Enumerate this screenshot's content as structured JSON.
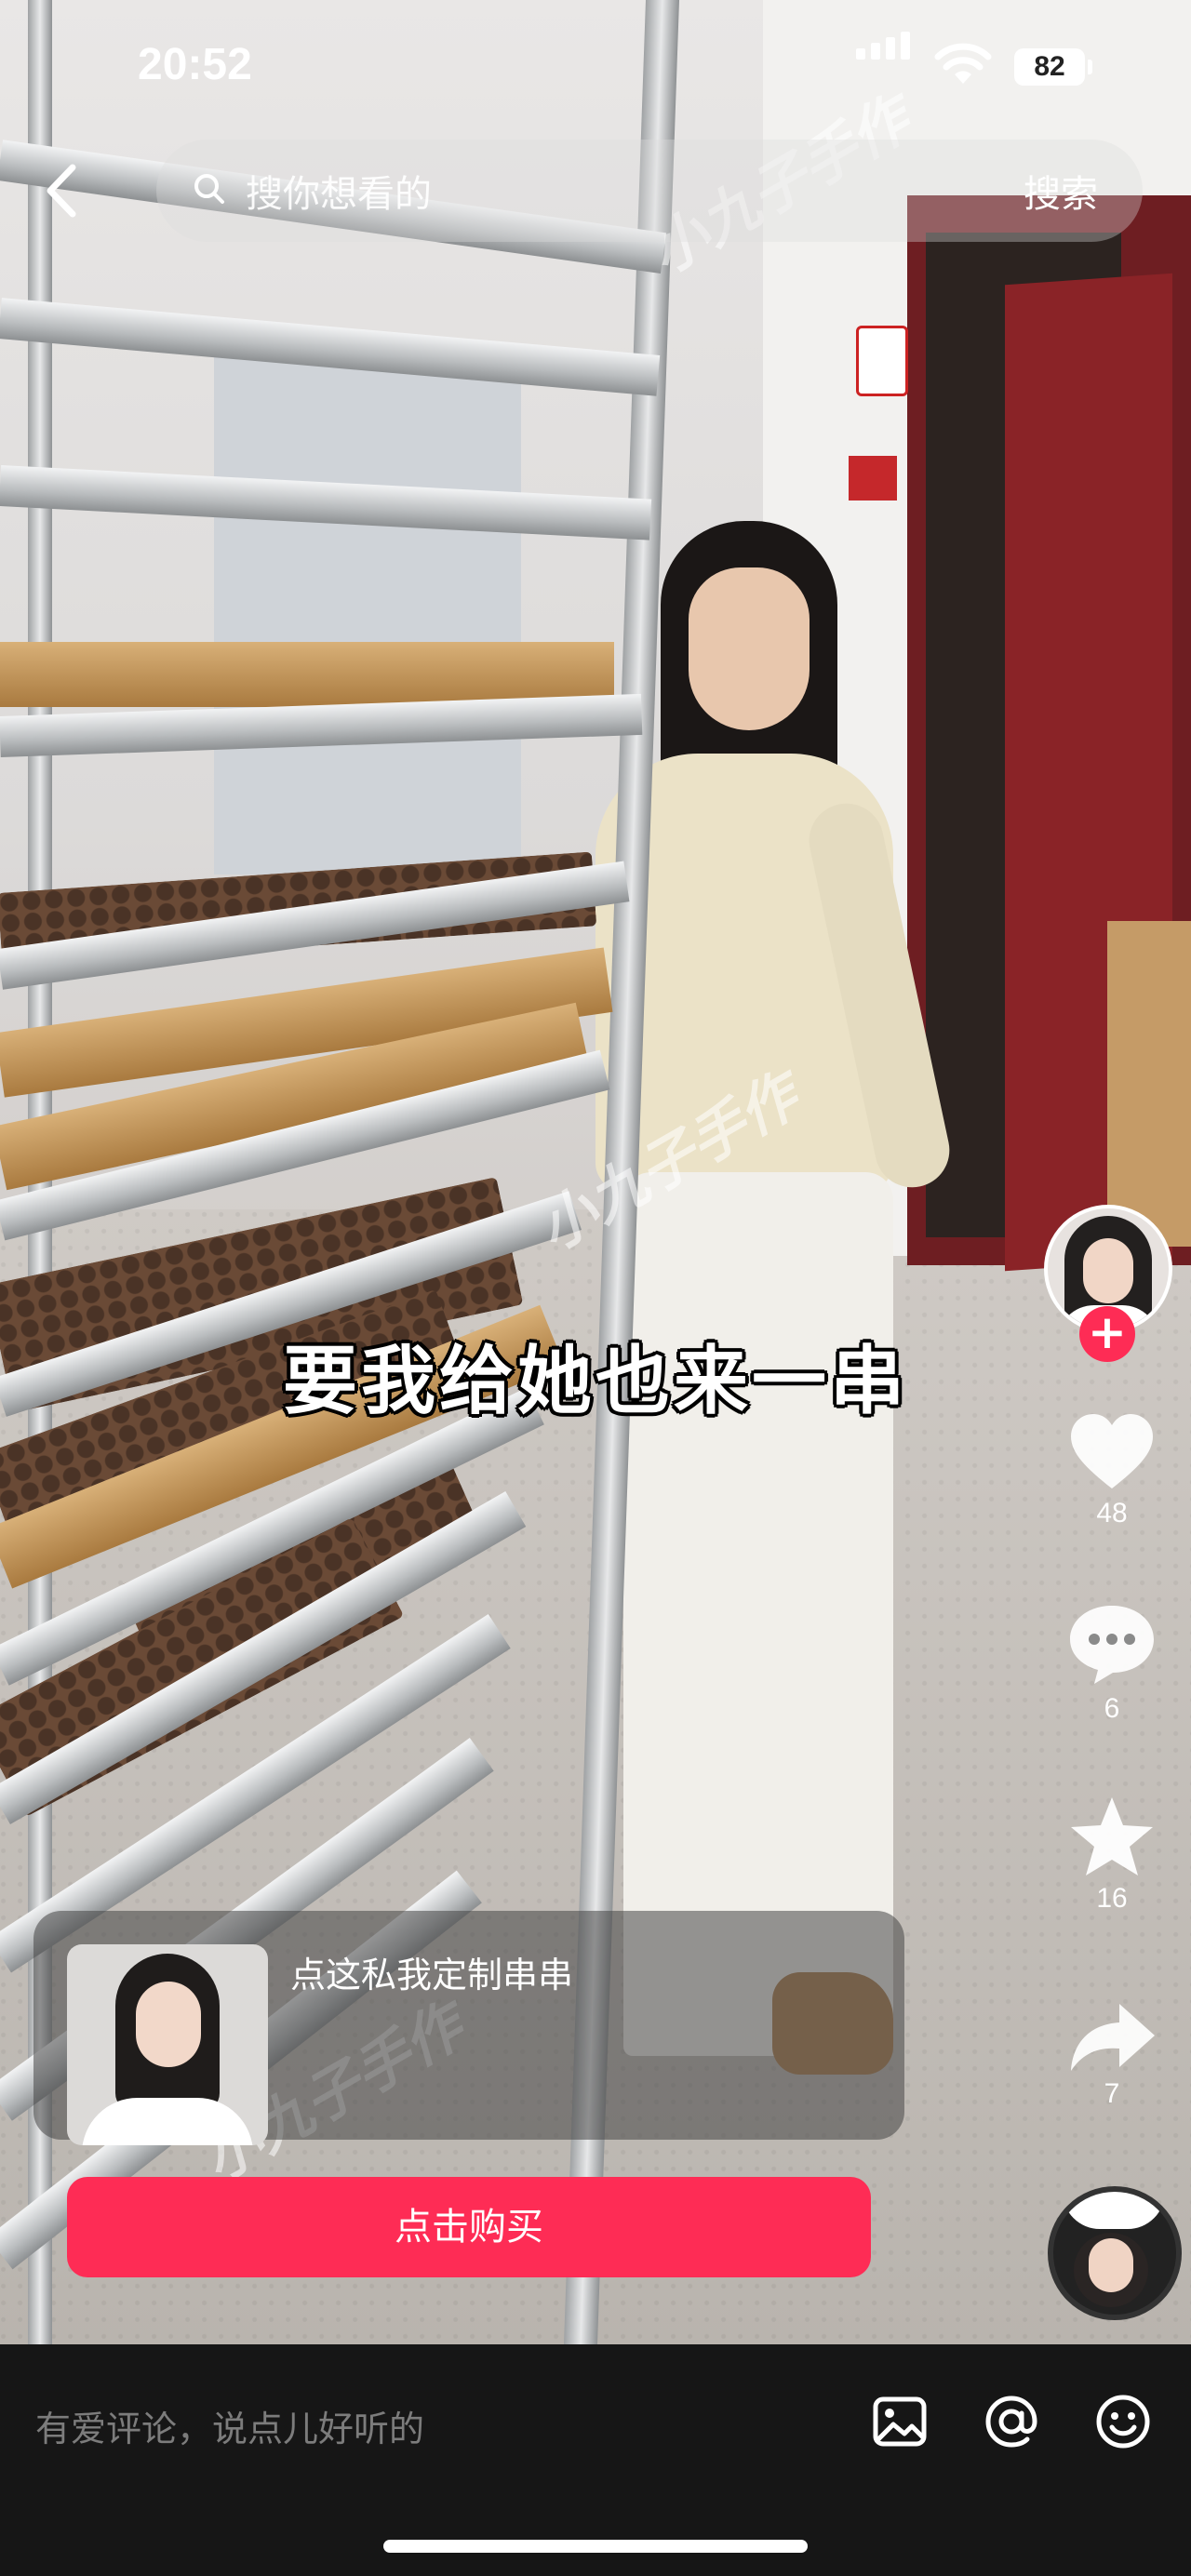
{
  "status_bar": {
    "time": "20:52",
    "battery": "82"
  },
  "top_bar": {
    "search_placeholder": "搜你想看的",
    "search_button": "搜索"
  },
  "video": {
    "caption": "要我给她也来一串",
    "watermark": "小九子手作"
  },
  "side_actions": {
    "likes": "48",
    "comments": "6",
    "favorites": "16",
    "shares": "7",
    "icons": [
      "plus-icon",
      "heart-icon",
      "comment-icon",
      "star-icon",
      "share-icon"
    ]
  },
  "promo": {
    "text": "点这私我定制串串",
    "buy_label": "点击购买"
  },
  "comment_bar": {
    "placeholder": "有爱评论，说点儿好听的",
    "icons": [
      "image-icon",
      "at-icon",
      "emoji-icon"
    ]
  },
  "colors": {
    "accent": "#fe2c55",
    "bottom_bar": "#161616"
  }
}
